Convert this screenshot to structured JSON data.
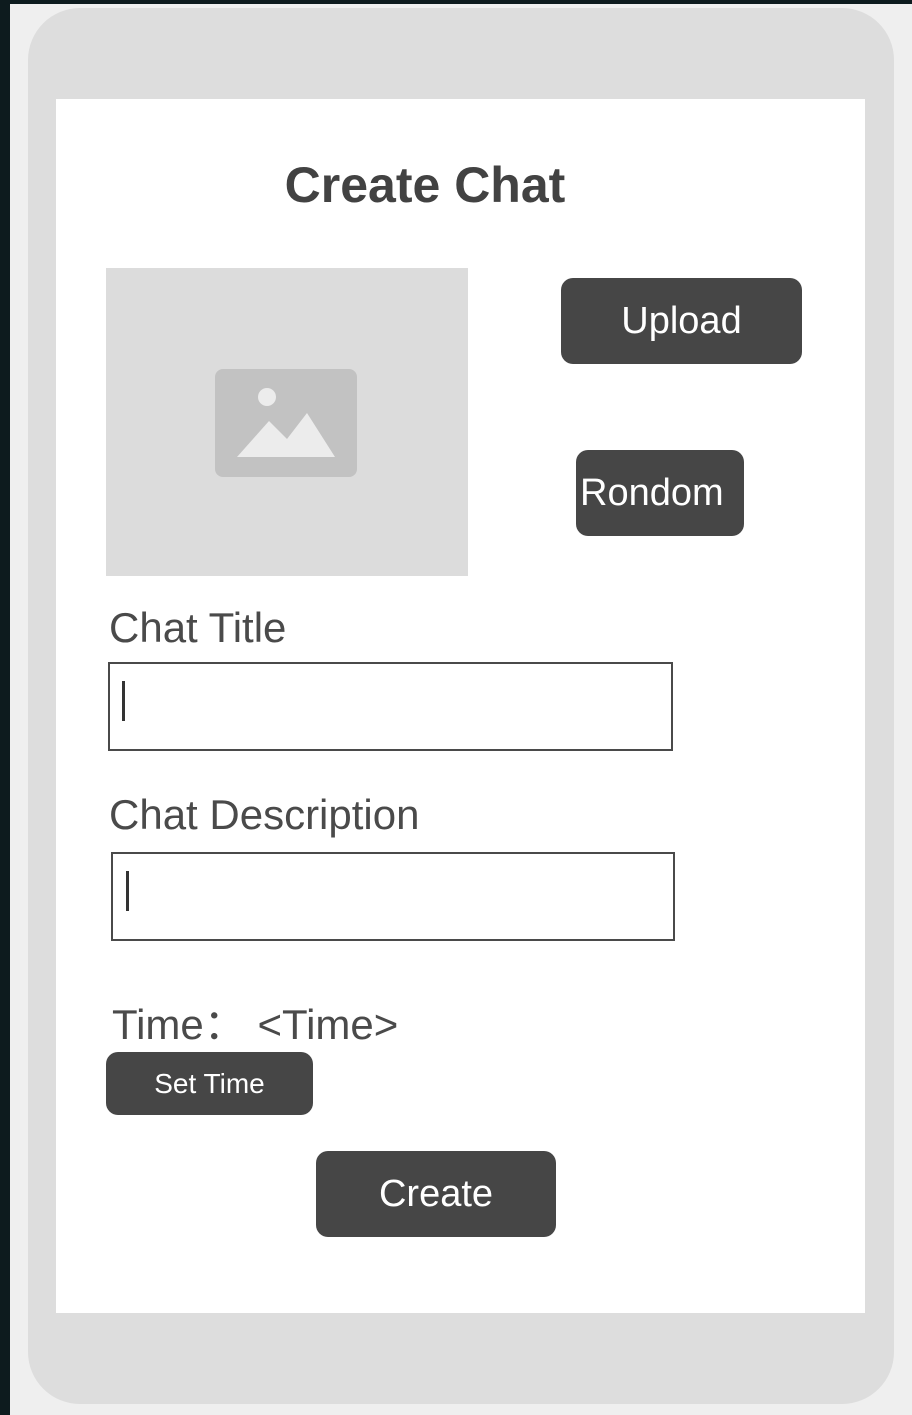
{
  "page": {
    "title": "Create Chat"
  },
  "avatar": {
    "placeholder_icon": "image-placeholder-icon"
  },
  "buttons": {
    "upload": "Upload",
    "random": "Rondom",
    "set_time": "Set Time",
    "create": "Create"
  },
  "form": {
    "chat_title_label": "Chat Title",
    "chat_title_value": "",
    "chat_description_label": "Chat Description",
    "chat_description_value": "",
    "time_label": "Time： <Time>"
  },
  "colors": {
    "button_bg": "#464646",
    "button_text": "#ffffff",
    "phone_body": "#dddddd",
    "placeholder_bg": "#dcdcdc",
    "icon_color": "#c2c2c2"
  }
}
